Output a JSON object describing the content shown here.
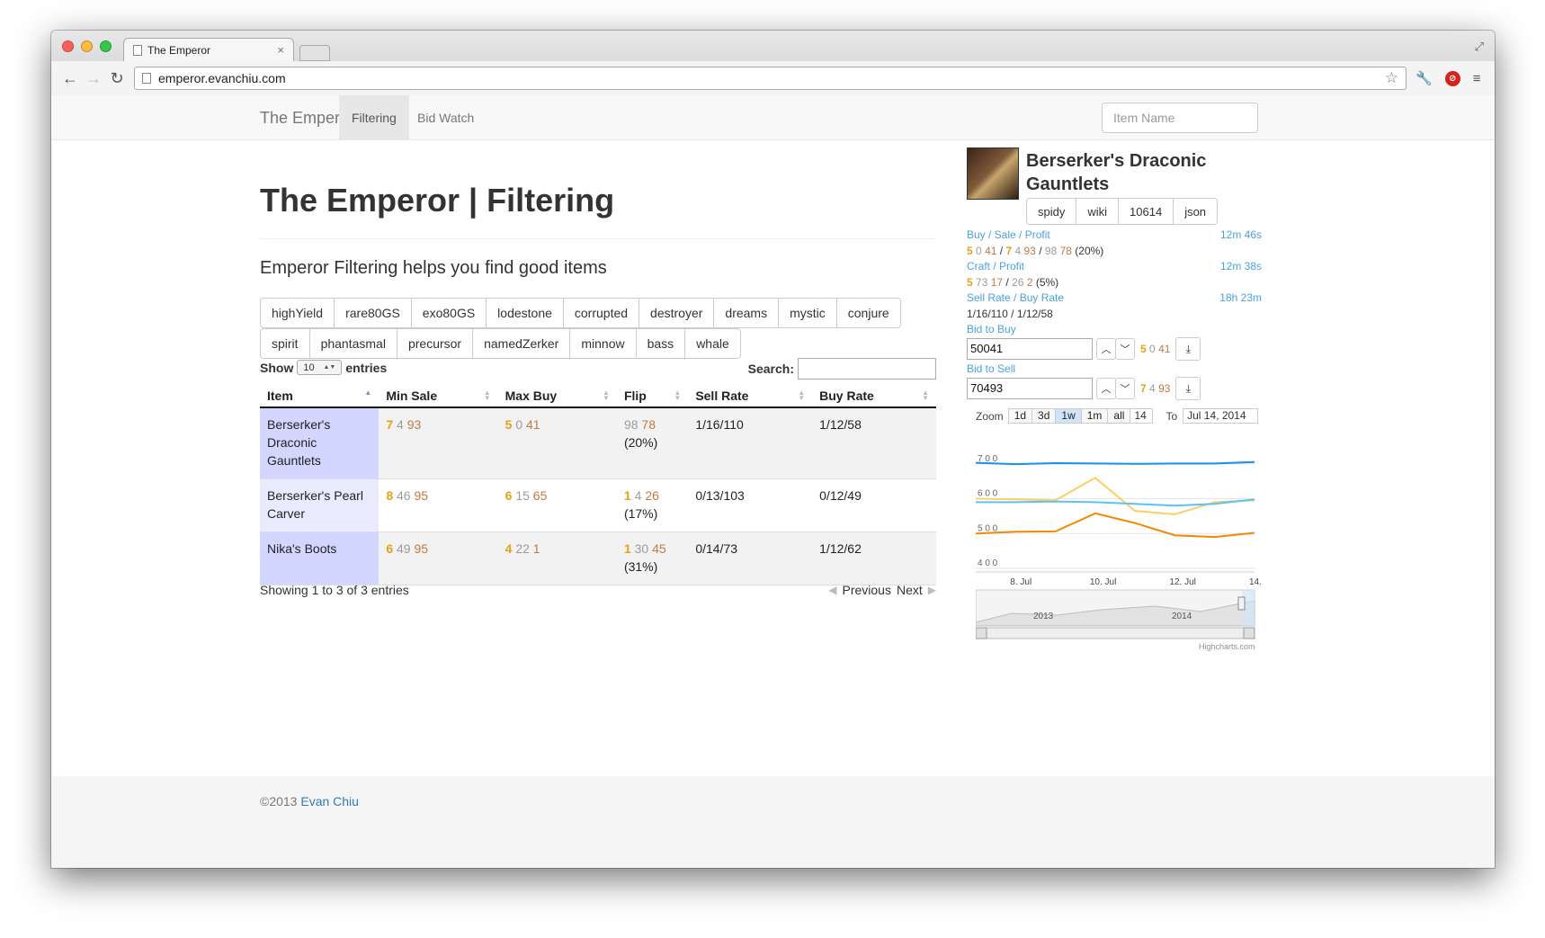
{
  "browser": {
    "tab_title": "The Emperor",
    "url": "emperor.evanchiu.com"
  },
  "navbar": {
    "brand": "The Emperor",
    "links": [
      {
        "label": "Filtering",
        "active": true
      },
      {
        "label": "Bid Watch",
        "active": false
      }
    ],
    "search_placeholder": "Item Name"
  },
  "main": {
    "title": "The Emperor | Filtering",
    "lead": "Emperor Filtering helps you find good items",
    "filters_row1": [
      "highYield",
      "rare80GS",
      "exo80GS",
      "lodestone",
      "corrupted",
      "destroyer",
      "dreams",
      "mystic",
      "conjure"
    ],
    "filters_row2": [
      "spirit",
      "phantasmal",
      "precursor",
      "namedZerker",
      "minnow",
      "bass",
      "whale"
    ]
  },
  "datatable": {
    "show_label": "Show",
    "entries_value": "10",
    "entries_label": "entries",
    "search_label": "Search:",
    "columns": [
      "Item",
      "Min Sale",
      "Max Buy",
      "Flip",
      "Sell Rate",
      "Buy Rate"
    ],
    "rows": [
      {
        "item": "Berserker's Draconic Gauntlets",
        "min_sale": [
          "7",
          "4",
          "93"
        ],
        "max_buy": [
          "5",
          "0",
          "41"
        ],
        "flip": [
          "",
          "98",
          "78"
        ],
        "flip_pct": "(20%)",
        "sell_rate": "1/16/110",
        "buy_rate": "1/12/58"
      },
      {
        "item": "Berserker's Pearl Carver",
        "min_sale": [
          "8",
          "46",
          "95"
        ],
        "max_buy": [
          "6",
          "15",
          "65"
        ],
        "flip": [
          "1",
          "4",
          "26"
        ],
        "flip_pct": "(17%)",
        "sell_rate": "0/13/103",
        "buy_rate": "0/12/49"
      },
      {
        "item": "Nika's Boots",
        "min_sale": [
          "6",
          "49",
          "95"
        ],
        "max_buy": [
          "4",
          "22",
          "1"
        ],
        "flip": [
          "1",
          "30",
          "45"
        ],
        "flip_pct": "(31%)",
        "sell_rate": "0/14/73",
        "buy_rate": "1/12/62"
      }
    ],
    "info": "Showing 1 to 3 of 3 entries",
    "prev": "Previous",
    "next": "Next"
  },
  "side": {
    "item_name": "Berserker's Draconic Gauntlets",
    "buttons": [
      "spidy",
      "wiki",
      "10614",
      "json"
    ],
    "buy_sale_label": "Buy / Sale / Profit",
    "buy_sale_time": "12m 46s",
    "buy_sale": {
      "buy_g": "5",
      "buy_s": "0",
      "buy_c": "41",
      "sale_g": "7",
      "sale_s": "4",
      "sale_c": "93",
      "profit_s": "98",
      "profit_c": "78",
      "pct": "(20%)"
    },
    "craft_label": "Craft / Profit",
    "craft_time": "12m 38s",
    "craft": {
      "craft_g": "5",
      "craft_s": "73",
      "craft_c": "17",
      "profit_s": "26",
      "profit_c": "2",
      "pct": "(5%)"
    },
    "rate_label": "Sell Rate / Buy Rate",
    "rate_time": "18h 23m",
    "rate_value": "1/16/110 / 1/12/58",
    "bid_buy_label": "Bid to Buy",
    "bid_buy_value": "50041",
    "bid_buy_coins": [
      "5",
      "0",
      "41"
    ],
    "bid_sell_label": "Bid to Sell",
    "bid_sell_value": "70493",
    "bid_sell_coins": [
      "7",
      "4",
      "93"
    ]
  },
  "chart": {
    "zoom_label": "Zoom",
    "zoom_buttons": [
      "1d",
      "3d",
      "1w",
      "1m",
      "all"
    ],
    "zoom_selected": "1w",
    "from_date_fragment": "14",
    "to_label": "To",
    "to_date": "Jul 14, 2014",
    "credit": "Highcharts.com",
    "navigator_labels": [
      "2013",
      "2014"
    ]
  },
  "chart_data": {
    "type": "line",
    "title": "",
    "y_ticks": [
      "7 0 0",
      "6 0 0",
      "5 0 0",
      "4 0 0"
    ],
    "ylim": [
      40000,
      72000
    ],
    "x_ticks": [
      "8. Jul",
      "10. Jul",
      "12. Jul",
      "14. Jul"
    ],
    "xlim": [
      "2014-07-07",
      "2014-07-14"
    ],
    "series": [
      {
        "color": "#1a8fea",
        "x": [
          "2014-07-07",
          "2014-07-08",
          "2014-07-09",
          "2014-07-10",
          "2014-07-11",
          "2014-07-12",
          "2014-07-13",
          "2014-07-14"
        ],
        "values": [
          70300,
          69900,
          70200,
          70100,
          70000,
          70100,
          70100,
          70500
        ]
      },
      {
        "color": "#ffcc66",
        "x": [
          "2014-07-07",
          "2014-07-08",
          "2014-07-09",
          "2014-07-10",
          "2014-07-11",
          "2014-07-12",
          "2014-07-13",
          "2014-07-14"
        ],
        "values": [
          60000,
          59800,
          59500,
          66000,
          56500,
          55500,
          59000,
          59500
        ]
      },
      {
        "color": "#59c3f5",
        "x": [
          "2014-07-07",
          "2014-07-08",
          "2014-07-09",
          "2014-07-10",
          "2014-07-11",
          "2014-07-12",
          "2014-07-13",
          "2014-07-14"
        ],
        "values": [
          59000,
          59000,
          59200,
          59000,
          58500,
          58000,
          58500,
          59800
        ]
      },
      {
        "color": "#f28a00",
        "x": [
          "2014-07-07",
          "2014-07-08",
          "2014-07-09",
          "2014-07-10",
          "2014-07-11",
          "2014-07-12",
          "2014-07-13",
          "2014-07-14"
        ],
        "values": [
          50000,
          50500,
          50600,
          55800,
          53000,
          49500,
          49000,
          50200
        ]
      }
    ]
  }
}
